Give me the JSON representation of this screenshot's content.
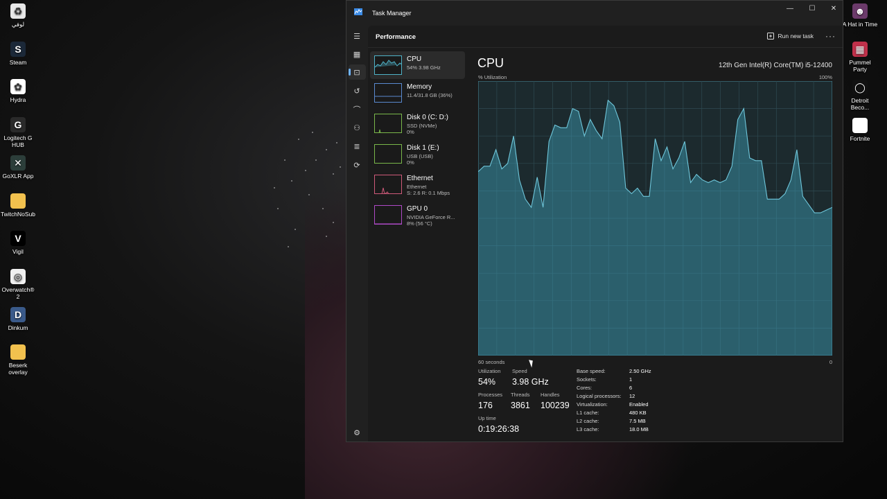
{
  "desktop_left": [
    {
      "label": "لوفي",
      "icon": "recycle-bin-icon",
      "color": "#e8e8e8",
      "glyph": "♻"
    },
    {
      "label": "Steam",
      "icon": "steam-icon",
      "color": "#1b2838",
      "glyph": "S"
    },
    {
      "label": "Hydra",
      "icon": "hydra-icon",
      "color": "#ffffff",
      "glyph": "✿"
    },
    {
      "label": "Logitech G HUB",
      "icon": "logitech-icon",
      "color": "#2a2a2a",
      "glyph": "G"
    },
    {
      "label": "GoXLR App",
      "icon": "goxlr-icon",
      "color": "#2c3e3a",
      "glyph": "✕"
    },
    {
      "label": "TwitchNoSub",
      "icon": "folder-icon",
      "color": "#f2c14e",
      "glyph": ""
    },
    {
      "label": "Vigil",
      "icon": "vigil-icon",
      "color": "#000000",
      "glyph": "V"
    },
    {
      "label": "Overwatch® 2",
      "icon": "overwatch-icon",
      "color": "#f0f0f0",
      "glyph": "◎"
    },
    {
      "label": "Dinkum",
      "icon": "dinkum-icon",
      "color": "#3a5a8a",
      "glyph": "D"
    },
    {
      "label": "Beserk overlay",
      "icon": "folder-icon",
      "color": "#f2c14e",
      "glyph": ""
    }
  ],
  "desktop_right": [
    {
      "label": "A Hat in Time",
      "icon": "hat-in-time-icon",
      "color": "#6b3a6a",
      "glyph": "☻"
    },
    {
      "label": "Pummel Party",
      "icon": "pummel-party-icon",
      "color": "#c0304a",
      "glyph": "▦"
    },
    {
      "label": "Detroit Beco...",
      "icon": "detroit-icon",
      "color": "#111111",
      "glyph": "◯"
    },
    {
      "label": "Fortnite",
      "icon": "file-icon",
      "color": "#ffffff",
      "glyph": ""
    }
  ],
  "window": {
    "title": "Task Manager",
    "minimize": "—",
    "maximize": "☐",
    "close": "✕"
  },
  "header": {
    "title": "Performance",
    "run_new_task": "Run new task",
    "more": "···"
  },
  "devices": [
    {
      "name": "CPU",
      "line1": "54% 3.98 GHz",
      "line2": "",
      "color": "#4fb3c8"
    },
    {
      "name": "Memory",
      "line1": "11.4/31.8 GB (36%)",
      "line2": "",
      "color": "#5a8ad0"
    },
    {
      "name": "Disk 0 (C: D:)",
      "line1": "SSD (NVMe)",
      "line2": "0%",
      "color": "#7ab84a"
    },
    {
      "name": "Disk 1 (E:)",
      "line1": "USB (USB)",
      "line2": "0%",
      "color": "#7ab84a"
    },
    {
      "name": "Ethernet",
      "line1": "Ethernet",
      "line2": "S: 2.6 R: 0.1 Mbps",
      "color": "#d05a7a"
    },
    {
      "name": "GPU 0",
      "line1": "NVIDIA GeForce R...",
      "line2": "8% (56 °C)",
      "color": "#b04ac8"
    }
  ],
  "cpu": {
    "title": "CPU",
    "model": "12th Gen Intel(R) Core(TM) i5-12400",
    "util_label": "% Utilization",
    "util_max": "100%",
    "time_label": "60 seconds",
    "zero_label": "0",
    "utilization_label": "Utilization",
    "utilization": "54%",
    "speed_label": "Speed",
    "speed": "3.98 GHz",
    "processes_label": "Processes",
    "processes": "176",
    "threads_label": "Threads",
    "threads": "3861",
    "handles_label": "Handles",
    "handles": "100239",
    "uptime_label": "Up time",
    "uptime": "0:19:26:38",
    "specs": [
      {
        "k": "Base speed:",
        "v": "2.50 GHz"
      },
      {
        "k": "Sockets:",
        "v": "1"
      },
      {
        "k": "Cores:",
        "v": "6"
      },
      {
        "k": "Logical processors:",
        "v": "12"
      },
      {
        "k": "Virtualization:",
        "v": "Enabled"
      },
      {
        "k": "L1 cache:",
        "v": "480 KB"
      },
      {
        "k": "L2 cache:",
        "v": "7.5 MB"
      },
      {
        "k": "L3 cache:",
        "v": "18.0 MB"
      }
    ]
  },
  "chart_data": {
    "type": "area",
    "x": [
      60,
      59,
      58,
      57,
      56,
      55,
      54,
      53,
      52,
      51,
      50,
      49,
      48,
      47,
      46,
      45,
      44,
      43,
      42,
      41,
      40,
      39,
      38,
      37,
      36,
      35,
      34,
      33,
      32,
      31,
      30,
      29,
      28,
      27,
      26,
      25,
      24,
      23,
      22,
      21,
      20,
      19,
      18,
      17,
      16,
      15,
      14,
      13,
      12,
      11,
      10,
      9,
      8,
      7,
      6,
      5,
      4,
      3,
      2,
      1,
      0
    ],
    "values": [
      67,
      69,
      69,
      75,
      68,
      70,
      80,
      64,
      57,
      54,
      65,
      54,
      78,
      84,
      83,
      83,
      90,
      89,
      80,
      86,
      82,
      79,
      93,
      91,
      85,
      61,
      59,
      61,
      58,
      58,
      79,
      71,
      76,
      68,
      72,
      78,
      63,
      66,
      64,
      63,
      64,
      63,
      64,
      69,
      86,
      90,
      72,
      71,
      71,
      57,
      57,
      57,
      59,
      64,
      75,
      58,
      55,
      52,
      52,
      53,
      54
    ],
    "ylim": [
      0,
      100
    ],
    "color": "#3e9fb8"
  }
}
